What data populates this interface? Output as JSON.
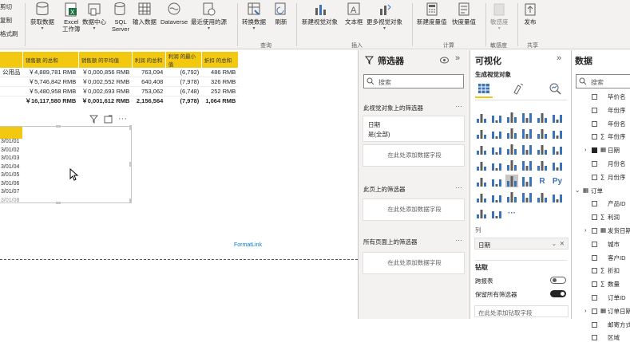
{
  "ribbon": {
    "clipboard": [
      "剪切",
      "复制",
      "格式刷"
    ],
    "buttons": [
      {
        "id": "get-data",
        "label": "获取数据",
        "dd": "▾"
      },
      {
        "id": "excel",
        "label": "Excel\n工作簿",
        "dd": ""
      },
      {
        "id": "data-hub",
        "label": "数据中心",
        "dd": "▾"
      },
      {
        "id": "sql",
        "label": "SQL\nServer",
        "dd": ""
      },
      {
        "id": "enter-data",
        "label": "输入数据",
        "dd": ""
      },
      {
        "id": "dataverse",
        "label": "Dataverse",
        "dd": ""
      },
      {
        "id": "recent",
        "label": "最近使用的源",
        "dd": "▾"
      },
      {
        "id": "transform",
        "label": "转换数据",
        "dd": "▾"
      },
      {
        "id": "refresh",
        "label": "刷新",
        "dd": ""
      },
      {
        "id": "new-visual",
        "label": "新建视觉对象",
        "dd": ""
      },
      {
        "id": "textbox",
        "label": "文本框",
        "dd": ""
      },
      {
        "id": "more-visuals",
        "label": "更多视觉对象",
        "dd": "▾"
      },
      {
        "id": "new-measure",
        "label": "新建度量值",
        "dd": ""
      },
      {
        "id": "quick-measure",
        "label": "快度量值",
        "dd": ""
      },
      {
        "id": "sensitivity",
        "label": "敏感度",
        "dd": "▾"
      },
      {
        "id": "publish",
        "label": "发布",
        "dd": ""
      }
    ],
    "groups": {
      "query": "查询",
      "insert": "插入",
      "calc": "计算",
      "sensitivity": "敏感度",
      "share": "共享"
    }
  },
  "table": {
    "headers": [
      "",
      "销售额 的总和",
      "销售额 的平均值",
      "利润 的总和",
      "利润 的最小值",
      "折扣 的总和"
    ],
    "rows": [
      [
        "公用品",
        "￥4,889,781 RMB",
        "￥0,000,856 RMB",
        "763,094",
        "(6,792)",
        "486 RMB"
      ],
      [
        "",
        "￥5,746,842 RMB",
        "￥0,002,552 RMB",
        "640,408",
        "(7,978)",
        "326 RMB"
      ],
      [
        "",
        "￥5,480,958 RMB",
        "￥0,002,693 RMB",
        "753,062",
        "(6,748)",
        "252 RMB"
      ]
    ],
    "total": [
      "",
      "￥16,117,580 RMB",
      "￥0,001,612 RMB",
      "2,156,564",
      "(7,978)",
      "1,064 RMB"
    ]
  },
  "date_visual": {
    "header": "",
    "rows": [
      "3/01/01",
      "3/01/02",
      "3/01/03",
      "3/01/04",
      "3/01/05",
      "3/01/06",
      "3/01/07",
      "3/01/08"
    ],
    "tools": [
      "filter-icon",
      "focus-icon",
      "more-icon"
    ]
  },
  "formatlink": "FormatLink",
  "filters": {
    "title": "筛选器",
    "search_placeholder": "搜索",
    "visual_section": "此视觉对象上的筛选器",
    "card_field": "日期",
    "card_value": "是(全部)",
    "add_field": "在此处添加数据字段",
    "page_section": "此页上的筛选器",
    "all_pages_section": "所有页面上的筛选器"
  },
  "viz": {
    "title": "可视化",
    "build": "生成视觉对象",
    "column_label": "列",
    "column_field": "日期",
    "drill_label": "钻取",
    "cross_report": "跨报表",
    "cross_report_state": "关",
    "keep_filters": "保留所有筛选器",
    "keep_filters_state": "开",
    "drill_add": "在此处添加钻取字段",
    "icons": [
      "stacked-bar",
      "stacked-column",
      "clustered-bar",
      "clustered-column",
      "100-bar",
      "100-column",
      "line",
      "area",
      "stacked-area",
      "line-column",
      "line-clustered",
      "ribbon",
      "waterfall",
      "funnel",
      "scatter",
      "pie",
      "donut",
      "treemap",
      "map",
      "filled-map",
      "shape-map",
      "gauge",
      "card",
      "multi-card",
      "kpi",
      "slicer",
      "table",
      "matrix",
      "R",
      "Py",
      "key-influencers",
      "decomp-tree",
      "qa",
      "narrative",
      "paginated",
      "trophy",
      "power-apps",
      "power-automate",
      "more"
    ]
  },
  "data": {
    "title": "数据",
    "search_placeholder": "搜索",
    "fields": [
      {
        "label": "毕价名",
        "indent": 1,
        "type": "field",
        "check": false
      },
      {
        "label": "年份序",
        "indent": 1,
        "type": "field",
        "check": false
      },
      {
        "label": "年份名",
        "indent": 1,
        "type": "field",
        "check": false
      },
      {
        "label": "年份序",
        "indent": 1,
        "type": "sigma",
        "check": false
      },
      {
        "label": "日期",
        "indent": 1,
        "type": "calendar",
        "check": true
      },
      {
        "label": "月份名",
        "indent": 1,
        "type": "field",
        "check": false
      },
      {
        "label": "月份序",
        "indent": 1,
        "type": "sigma",
        "check": false
      },
      {
        "label": "订单",
        "indent": 0,
        "type": "table",
        "check": false
      },
      {
        "label": "产品ID",
        "indent": 1,
        "type": "field",
        "check": false
      },
      {
        "label": "利润",
        "indent": 1,
        "type": "sigma",
        "check": false
      },
      {
        "label": "发货日期",
        "indent": 1,
        "type": "calendar",
        "check": false
      },
      {
        "label": "城市",
        "indent": 1,
        "type": "field",
        "check": false
      },
      {
        "label": "客户ID",
        "indent": 1,
        "type": "field",
        "check": false
      },
      {
        "label": "折扣",
        "indent": 1,
        "type": "sigma",
        "check": false
      },
      {
        "label": "数量",
        "indent": 1,
        "type": "sigma",
        "check": false
      },
      {
        "label": "订单ID",
        "indent": 1,
        "type": "field",
        "check": false
      },
      {
        "label": "订单日期",
        "indent": 1,
        "type": "calendar",
        "check": false
      },
      {
        "label": "邮寄方式",
        "indent": 1,
        "type": "field",
        "check": false
      },
      {
        "label": "区域",
        "indent": 1,
        "type": "field",
        "check": false
      }
    ]
  }
}
